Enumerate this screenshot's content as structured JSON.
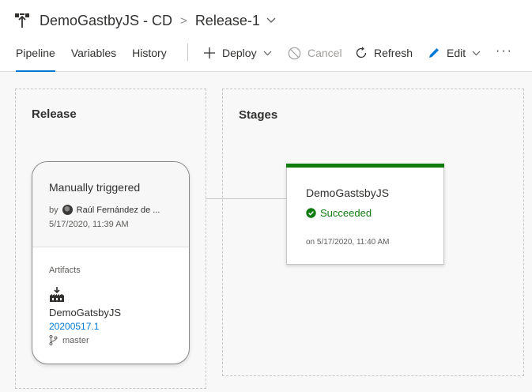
{
  "header": {
    "pipeline_name": "DemoGastbyJS - CD",
    "separator": ">",
    "release_name": "Release-1"
  },
  "tabs": [
    {
      "label": "Pipeline",
      "active": true
    },
    {
      "label": "Variables",
      "active": false
    },
    {
      "label": "History",
      "active": false
    }
  ],
  "toolbar": {
    "deploy": "Deploy",
    "cancel": "Cancel",
    "refresh": "Refresh",
    "edit": "Edit",
    "more": "···"
  },
  "release_panel": {
    "title": "Release",
    "trigger": "Manually triggered",
    "by_label": "by",
    "by_user": "Raúl Fernández de ...",
    "created": "5/17/2020, 11:39 AM",
    "artifacts_heading": "Artifacts",
    "artifact": {
      "name": "DemoGatsbyJS",
      "version": "20200517.1",
      "branch": "master"
    }
  },
  "stages_panel": {
    "title": "Stages",
    "stage": {
      "name": "DemoGastsbyJS",
      "status": "Succeeded",
      "completed": "on 5/17/2020, 11:40 AM"
    }
  },
  "colors": {
    "accent": "#0078d4",
    "success": "#107c10",
    "disabled": "#a19f9d"
  }
}
